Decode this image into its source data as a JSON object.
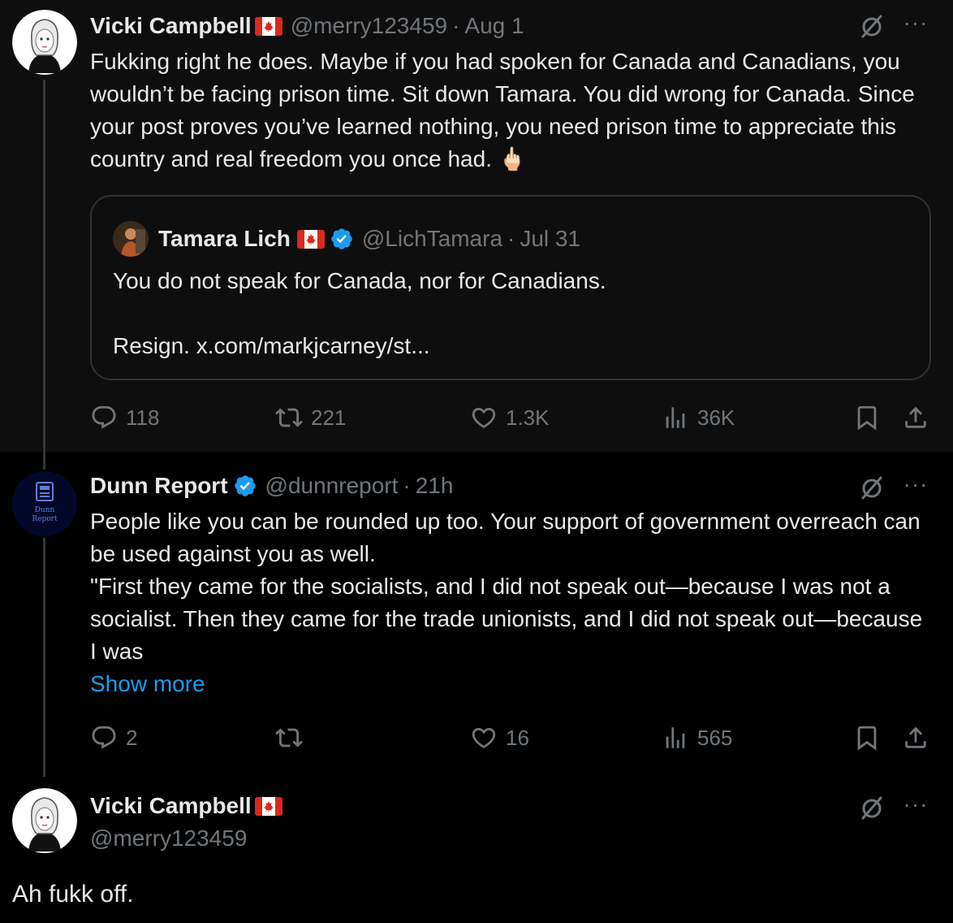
{
  "posts": [
    {
      "author": "Vicki Campbell",
      "handle": "@merry123459",
      "time": "Aug 1",
      "text": "Fukking right he does. Maybe if you had spoken for Canada and Canadians, you wouldn’t be facing prison time. Sit down Tamara. You did wrong for Canada. Since your post proves you’ve learned nothing, you need prison time to appreciate this country and real freedom you once had. 🖕🏻",
      "quote": {
        "author": "Tamara Lich",
        "handle": "@LichTamara",
        "time": "Jul 31",
        "line1": "You do not speak for Canada, nor for Canadians.",
        "line2": "Resign. x.com/markjcarney/st..."
      },
      "stats": {
        "replies": "118",
        "reposts": "221",
        "likes": "1.3K",
        "views": "36K"
      }
    },
    {
      "author": "Dunn Report",
      "handle": "@dunnreport",
      "time": "21h",
      "avatar_text_line1": "Dunn",
      "avatar_text_line2": "Report",
      "text_line1": "People like you can be rounded up too. Your support of government overreach can be used against you as well.",
      "text_line2": "\"First they came for the socialists, and I did not speak out—because I was not a socialist. Then they came for the trade unionists, and I did not speak out—because I was",
      "show_more": "Show more",
      "stats": {
        "replies": "2",
        "reposts": "",
        "likes": "16",
        "views": "565"
      }
    },
    {
      "author": "Vicki Campbell",
      "handle": "@merry123459",
      "text": "Ah fukk off."
    }
  ],
  "colors": {
    "background": "#000000",
    "highlighted_post_bg": "#0e0e0e",
    "text": "#e7e9ea",
    "muted": "#71767b",
    "link": "#1d9bf0",
    "verified": "#1d9bf0",
    "border": "#2f3336"
  },
  "icons": {
    "reply": "reply-icon",
    "repost": "repost-icon",
    "like": "heart-icon",
    "views": "views-icon",
    "bookmark": "bookmark-icon",
    "share": "share-icon",
    "grok": "grok-icon",
    "more": "more-icon"
  }
}
